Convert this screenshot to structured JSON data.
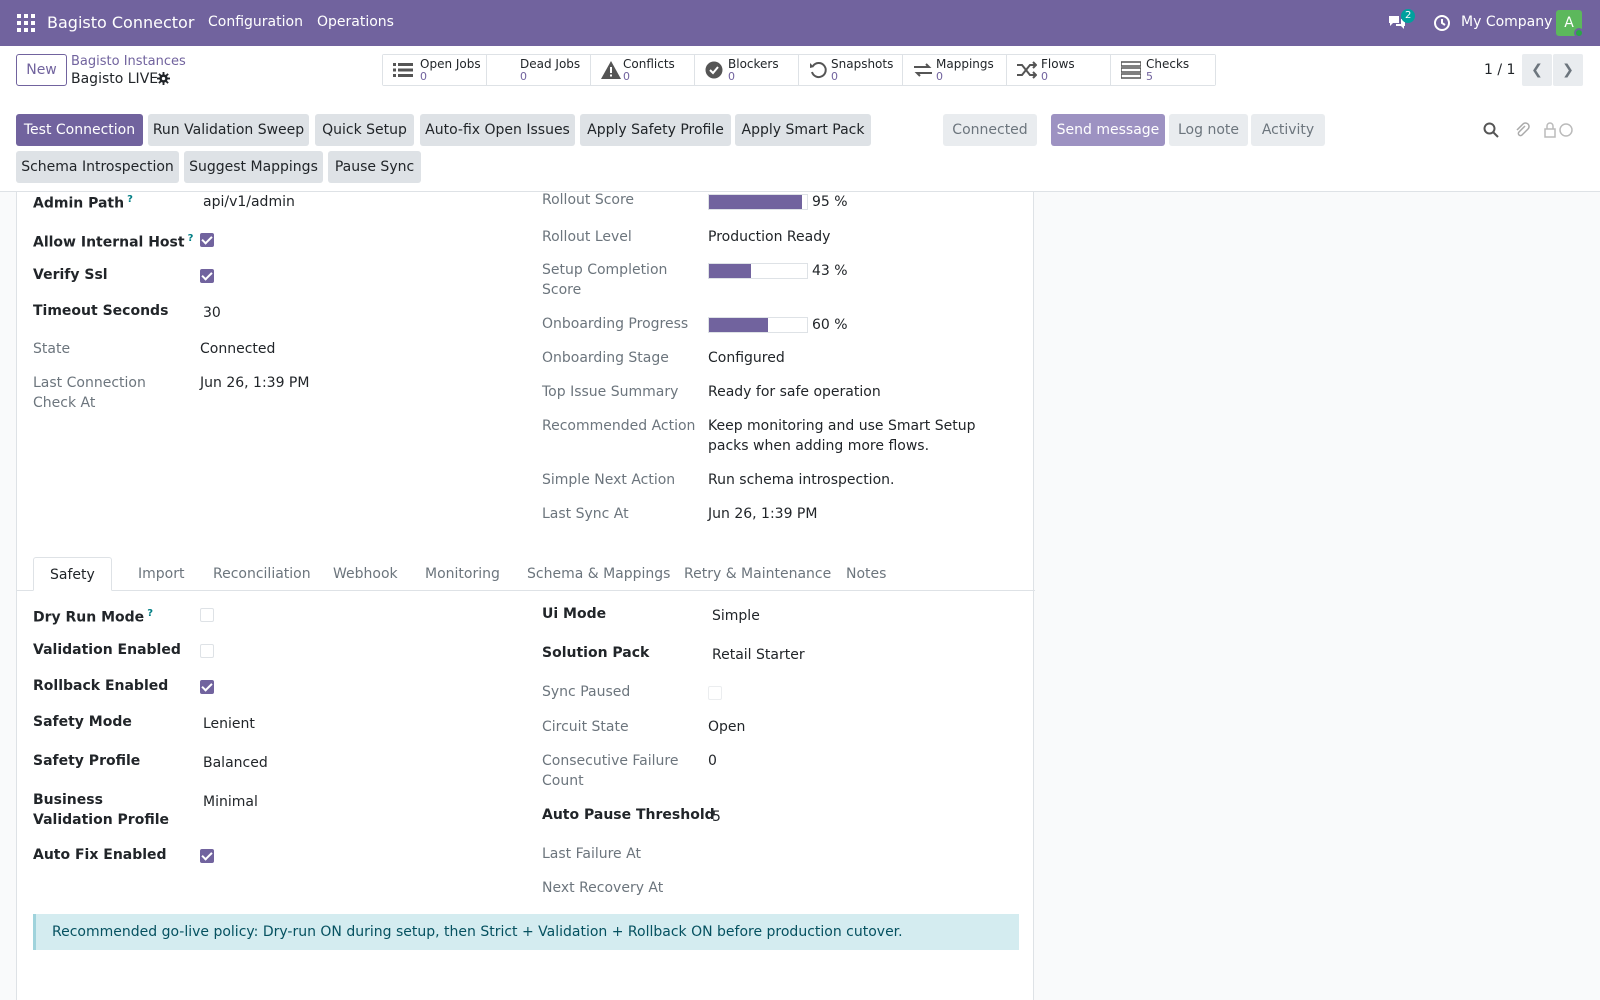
{
  "navbar": {
    "brand": "Bagisto Connector",
    "menu": [
      "Configuration",
      "Operations"
    ],
    "chat_count": "2",
    "company": "My Company",
    "avatar_letter": "A"
  },
  "control": {
    "new_label": "New",
    "breadcrumb_parent": "Bagisto Instances",
    "breadcrumb_current": "Bagisto LIVE",
    "pager": "1 / 1",
    "stats": [
      {
        "label": "Open Jobs",
        "value": "0",
        "icon": "list-icon"
      },
      {
        "label": "Dead Jobs",
        "value": "0",
        "icon": "none"
      },
      {
        "label": "Conflicts",
        "value": "0",
        "icon": "warning-icon"
      },
      {
        "label": "Blockers",
        "value": "0",
        "icon": "check-circle-icon"
      },
      {
        "label": "Snapshots",
        "value": "0",
        "icon": "history-icon"
      },
      {
        "label": "Mappings",
        "value": "0",
        "icon": "exchange-icon"
      },
      {
        "label": "Flows",
        "value": "0",
        "icon": "random-icon"
      },
      {
        "label": "Checks",
        "value": "5",
        "icon": "tasks-icon"
      }
    ],
    "actions_row1": [
      "Test Connection",
      "Run Validation Sweep",
      "Quick Setup",
      "Auto-fix Open Issues",
      "Apply Safety Profile",
      "Apply Smart Pack"
    ],
    "actions_row2": [
      "Schema Introspection",
      "Suggest Mappings",
      "Pause Sync"
    ],
    "status": "Connected",
    "chatter": {
      "send_message": "Send message",
      "log_note": "Log note",
      "activity": "Activity"
    }
  },
  "left_top": [
    {
      "label": "Admin Path",
      "value": "api/v1/admin",
      "help": "?"
    },
    {
      "label": "Allow Internal Host",
      "help": "?",
      "checked": true
    },
    {
      "label": "Verify Ssl",
      "checked": true
    },
    {
      "label": "Timeout Seconds",
      "value": "30"
    },
    {
      "label": "State",
      "value": "Connected"
    },
    {
      "label": "Last Connection Check At",
      "value": "Jun 26, 1:39 PM"
    }
  ],
  "right_top": {
    "rollout_score": {
      "label": "Rollout Score",
      "percent": 95,
      "text": "95 %"
    },
    "rollout_level": {
      "label": "Rollout Level",
      "value": "Production Ready"
    },
    "setup_completion": {
      "label": "Setup Completion Score",
      "percent": 43,
      "text": "43 %"
    },
    "onboarding_progress": {
      "label": "Onboarding Progress",
      "percent": 60,
      "text": "60 %"
    },
    "onboarding_stage": {
      "label": "Onboarding Stage",
      "value": "Configured"
    },
    "top_issue": {
      "label": "Top Issue Summary",
      "value": "Ready for safe operation"
    },
    "recommended_action": {
      "label": "Recommended Action",
      "value": "Keep monitoring and use Smart Setup packs when adding more flows."
    },
    "simple_next": {
      "label": "Simple Next Action",
      "value": "Run schema introspection."
    },
    "last_sync": {
      "label": "Last Sync At",
      "value": "Jun 26, 1:39 PM"
    }
  },
  "tabs": [
    "Safety",
    "Import",
    "Reconciliation",
    "Webhook",
    "Monitoring",
    "Schema & Mappings",
    "Retry & Maintenance",
    "Notes"
  ],
  "safety_left": {
    "dry_run": {
      "label": "Dry Run Mode",
      "help": "?",
      "checked": false
    },
    "validation": {
      "label": "Validation Enabled",
      "checked": false
    },
    "rollback": {
      "label": "Rollback Enabled",
      "checked": true
    },
    "safety_mode": {
      "label": "Safety Mode",
      "value": "Lenient"
    },
    "safety_profile": {
      "label": "Safety Profile",
      "value": "Balanced"
    },
    "business_validation": {
      "label": "Business Validation Profile",
      "value": "Minimal"
    },
    "auto_fix": {
      "label": "Auto Fix Enabled",
      "checked": true
    }
  },
  "safety_right": {
    "ui_mode": {
      "label": "Ui Mode",
      "value": "Simple"
    },
    "solution_pack": {
      "label": "Solution Pack",
      "value": "Retail Starter"
    },
    "sync_paused": {
      "label": "Sync Paused",
      "checked": false
    },
    "circuit_state": {
      "label": "Circuit State",
      "value": "Open"
    },
    "consecutive_failure": {
      "label": "Consecutive Failure Count",
      "value": "0"
    },
    "auto_pause": {
      "label": "Auto Pause Threshold",
      "value": "5"
    },
    "last_failure": {
      "label": "Last Failure At",
      "value": ""
    },
    "next_recovery": {
      "label": "Next Recovery At",
      "value": ""
    }
  },
  "alert": "Recommended go-live policy: Dry-run ON during setup, then Strict + Validation + Rollback ON before production cutover.",
  "colors": {
    "brand": "#71639e",
    "alert_bg": "#d4ecf0"
  }
}
